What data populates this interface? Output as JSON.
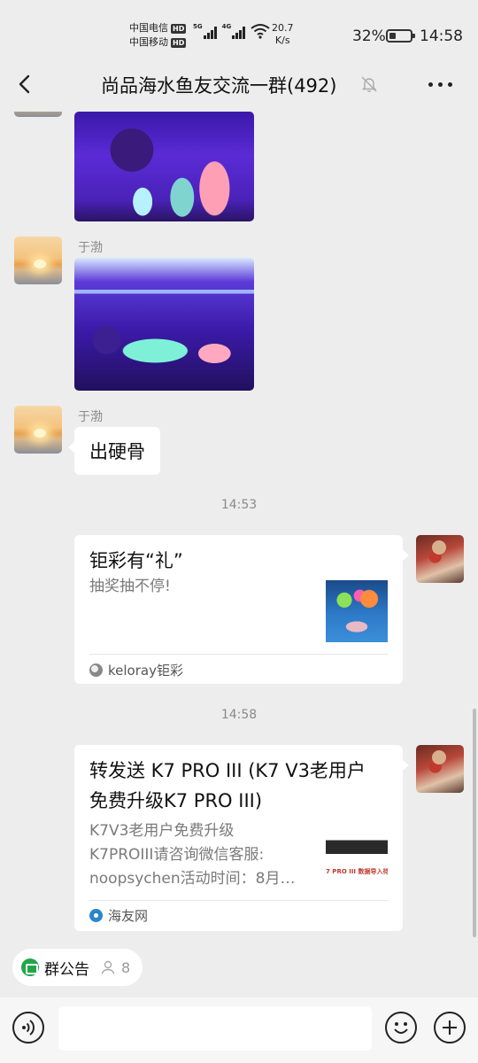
{
  "status_bar": {
    "carrier1": "中国电信",
    "carrier2": "中国移动",
    "hd": "HD",
    "sig1": "5G",
    "sig2": "4G",
    "speed_value": "20.7",
    "speed_unit": "K/s",
    "battery": "32%",
    "battery_level": 0.32,
    "time": "14:58"
  },
  "header": {
    "title": "尚品海水鱼友交流一群(492)",
    "back_icon": "chevron-left-icon",
    "mute_icon": "bell-off-icon",
    "more_icon": "more-dots-icon"
  },
  "messages": {
    "sender1": "于渤",
    "sender2": "于渤",
    "text_msg": "出硬骨",
    "time1": "14:53",
    "card1": {
      "title": "钜彩有“礼”",
      "desc": "抽奖抽不停!",
      "source": "keloray钜彩"
    },
    "time2": "14:58",
    "card2": {
      "title_line1": "转发送 K7 PRO III (K7 V3老用户",
      "title_line2": "免费升级K7 PRO III)",
      "desc_line1": "K7V3老用户免费升级",
      "desc_line2": "K7PROIII请咨询微信客服:",
      "desc_line3": "noopsychen活动时间：8月…",
      "source": "海友网",
      "thumb_text": "7 PRO III  数据导入待"
    }
  },
  "notice": {
    "label": "群公告",
    "member_count": "8"
  },
  "input": {
    "placeholder": ""
  },
  "colors": {
    "background": "#ededed",
    "bubble": "#ffffff",
    "notice_green": "#22a64a",
    "muted_text": "#8a8a8a"
  }
}
